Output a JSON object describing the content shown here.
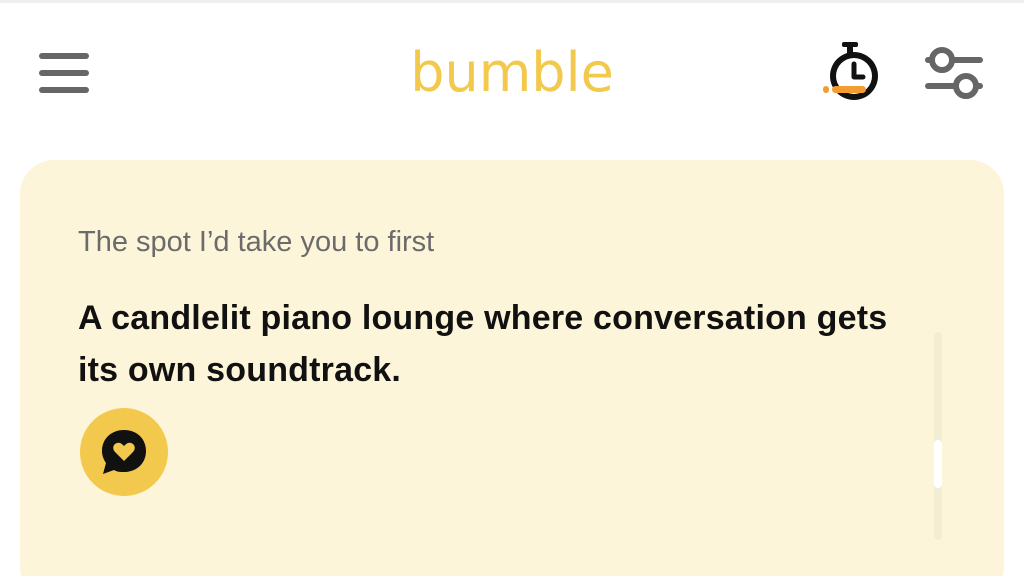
{
  "header": {
    "logo_text": "bumble",
    "brand_color": "#f2c94c",
    "menu_icon": "hamburger-menu-icon",
    "timer_icon": "stopwatch-icon",
    "filter_icon": "sliders-filter-icon"
  },
  "card": {
    "background_color": "#fdf5d9",
    "prompt_label": "The spot I’d take you to first",
    "prompt_answer": "A candlelit piano lounge where conversation gets its own soundtrack.",
    "comment_icon": "heart-speech-bubble-icon"
  }
}
